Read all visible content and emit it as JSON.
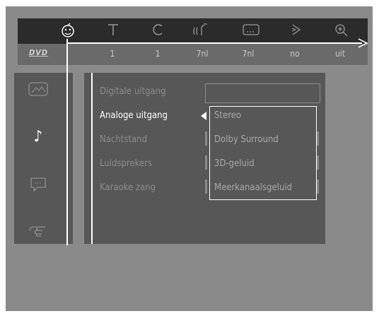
{
  "toolbar": {
    "icons": [
      "disc-face-icon",
      "text-icon",
      "repeat-icon",
      "audio-waves-icon",
      "subtitle-icon",
      "angle-icon",
      "zoom-icon"
    ]
  },
  "status": {
    "dvd_label": "DVD",
    "values": [
      "1",
      "1",
      "7nl",
      "7nl",
      "no",
      "uit"
    ]
  },
  "sidebar": {
    "icons": [
      "picture-icon",
      "music-note-icon",
      "speech-bubble-icon",
      "hand-icon"
    ],
    "active": "music-note-icon"
  },
  "menu": {
    "items": [
      "Digitale uitgang",
      "Analoge uitgang",
      "Nachtstand",
      "Luidsprekers",
      "Karaoke zang"
    ],
    "selected": "Analoge uitgang"
  },
  "submenu": {
    "options": [
      "Stereo",
      "Dolby Surround",
      "3D-geluid",
      "Meerkanaalsgeluid"
    ]
  },
  "colors": {
    "screen_bg": "#8a8a8a",
    "panel_bg": "#575757",
    "topbar_bg": "#2b2b2b",
    "status_bg": "#6a6a6a",
    "highlight": "#ffffff",
    "inactive_text": "#8c8c8c"
  }
}
